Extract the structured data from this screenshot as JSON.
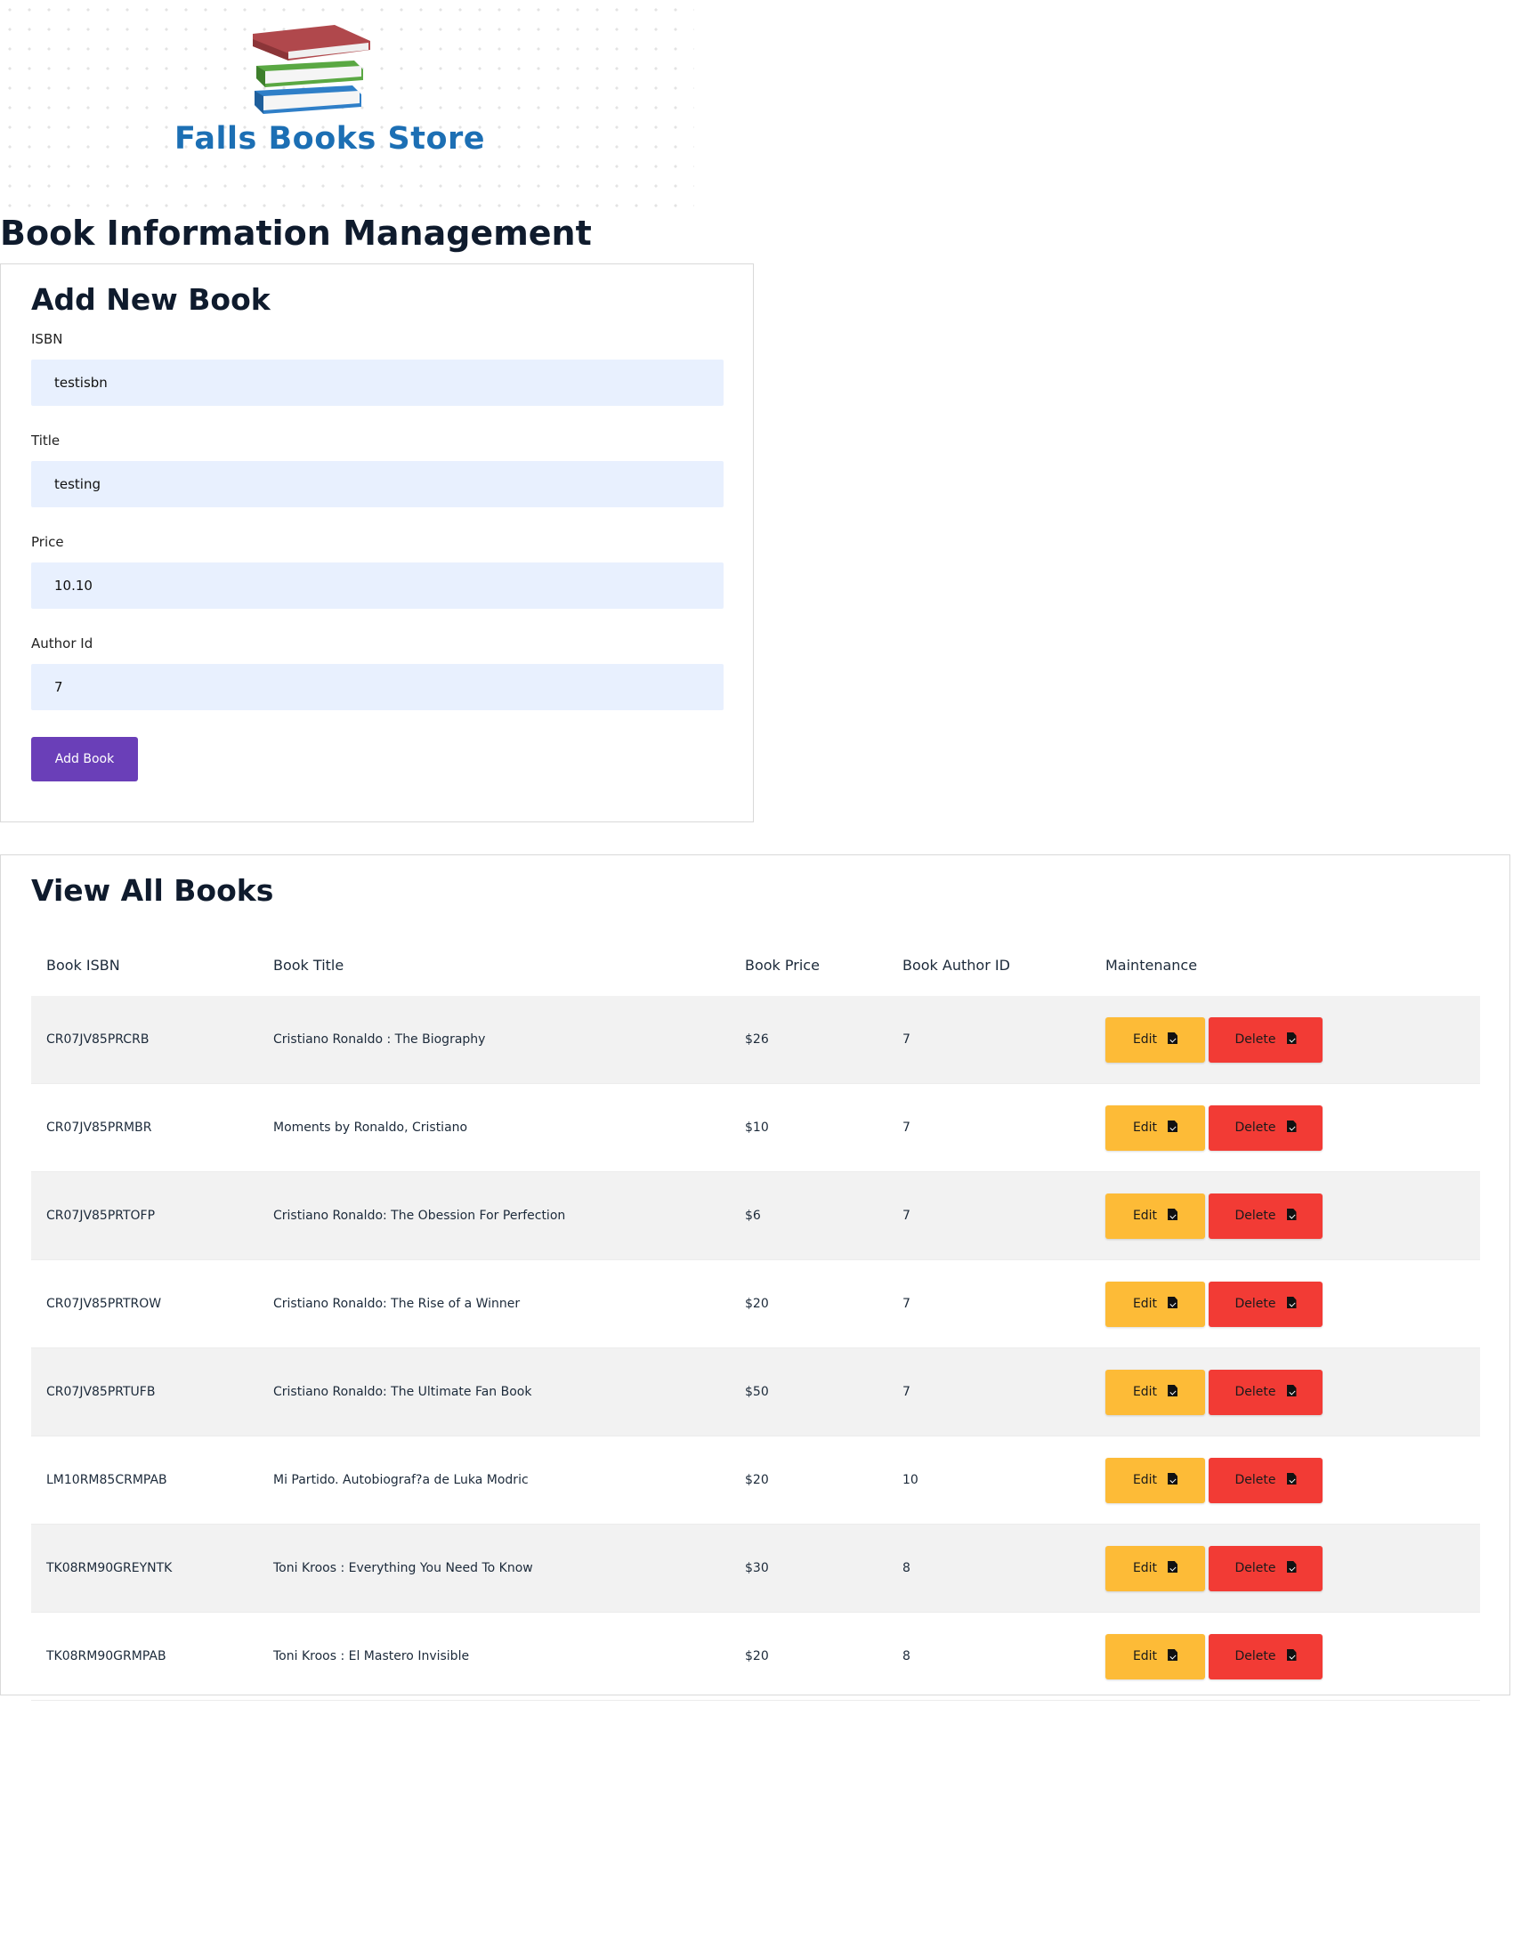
{
  "brand": {
    "name": "Falls Books Store"
  },
  "page_title": "Book Information Management",
  "add_form": {
    "title": "Add New Book",
    "fields": [
      {
        "label": "ISBN",
        "value": "testisbn"
      },
      {
        "label": "Title",
        "value": "testing"
      },
      {
        "label": "Price",
        "value": "10.10"
      },
      {
        "label": "Author Id",
        "value": "7"
      }
    ],
    "submit_label": "Add Book",
    "submit_color": "#6a3fb8"
  },
  "books": {
    "title": "View All Books",
    "columns": [
      "Book ISBN",
      "Book Title",
      "Book Price",
      "Book Author ID",
      "Maintenance"
    ],
    "edit_label": "Edit",
    "delete_label": "Delete",
    "edit_color": "#fdbb37",
    "delete_color": "#f23b35",
    "rows": [
      {
        "isbn": "CR07JV85PRCRB",
        "title": "Cristiano Ronaldo : The Biography",
        "price": "$26",
        "author_id": "7"
      },
      {
        "isbn": "CR07JV85PRMBR",
        "title": "Moments by Ronaldo, Cristiano",
        "price": "$10",
        "author_id": "7"
      },
      {
        "isbn": "CR07JV85PRTOFP",
        "title": "Cristiano Ronaldo: The Obession For Perfection",
        "price": "$6",
        "author_id": "7"
      },
      {
        "isbn": "CR07JV85PRTROW",
        "title": "Cristiano Ronaldo: The Rise of a Winner",
        "price": "$20",
        "author_id": "7"
      },
      {
        "isbn": "CR07JV85PRTUFB",
        "title": "Cristiano Ronaldo: The Ultimate Fan Book",
        "price": "$50",
        "author_id": "7"
      },
      {
        "isbn": "LM10RM85CRMPAB",
        "title": "Mi Partido. Autobiograf?a de Luka Modric",
        "price": "$20",
        "author_id": "10"
      },
      {
        "isbn": "TK08RM90GREYNTK",
        "title": "Toni Kroos : Everything You Need To Know",
        "price": "$30",
        "author_id": "8"
      },
      {
        "isbn": "TK08RM90GRMPAB",
        "title": "Toni Kroos : El Mastero Invisible",
        "price": "$20",
        "author_id": "8"
      }
    ]
  }
}
